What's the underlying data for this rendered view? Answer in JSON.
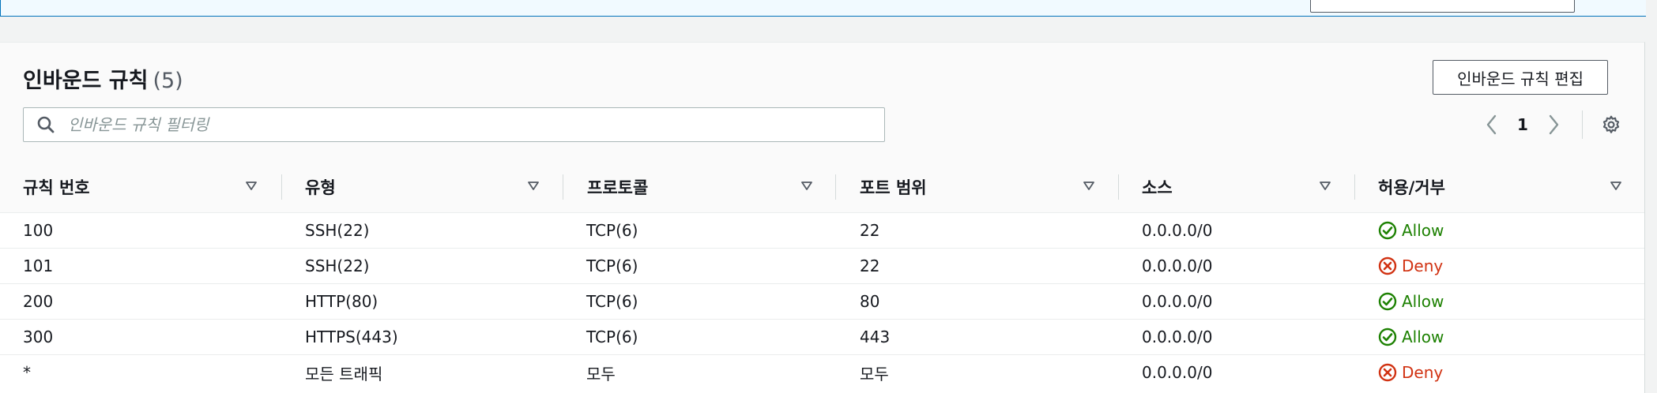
{
  "panel": {
    "title": "인바운드 규칙",
    "count": "(5)",
    "edit_button_label": "인바운드 규칙 편집"
  },
  "filter": {
    "placeholder": "인바운드 규칙 필터링",
    "value": ""
  },
  "pagination": {
    "current_page": "1"
  },
  "table": {
    "columns": [
      "규칙 번호",
      "유형",
      "프로토콜",
      "포트 범위",
      "소스",
      "허용/거부"
    ],
    "rows": [
      {
        "rule": "100",
        "type": "SSH(22)",
        "protocol": "TCP(6)",
        "port": "22",
        "source": "0.0.0.0/0",
        "action": "Allow"
      },
      {
        "rule": "101",
        "type": "SSH(22)",
        "protocol": "TCP(6)",
        "port": "22",
        "source": "0.0.0.0/0",
        "action": "Deny"
      },
      {
        "rule": "200",
        "type": "HTTP(80)",
        "protocol": "TCP(6)",
        "port": "80",
        "source": "0.0.0.0/0",
        "action": "Allow"
      },
      {
        "rule": "300",
        "type": "HTTPS(443)",
        "protocol": "TCP(6)",
        "port": "443",
        "source": "0.0.0.0/0",
        "action": "Allow"
      },
      {
        "rule": "*",
        "type": "모든 트래픽",
        "protocol": "모두",
        "port": "모두",
        "source": "0.0.0.0/0",
        "action": "Deny"
      }
    ]
  },
  "icons": {
    "search": "search-icon",
    "prev": "chevron-left-icon",
    "next": "chevron-right-icon",
    "settings": "gear-icon",
    "sort": "sort-caret-icon",
    "allow": "check-circle-icon",
    "deny": "x-circle-icon"
  },
  "colors": {
    "allow": "#1d8102",
    "deny": "#d13212",
    "banner_border": "#0073bb"
  }
}
